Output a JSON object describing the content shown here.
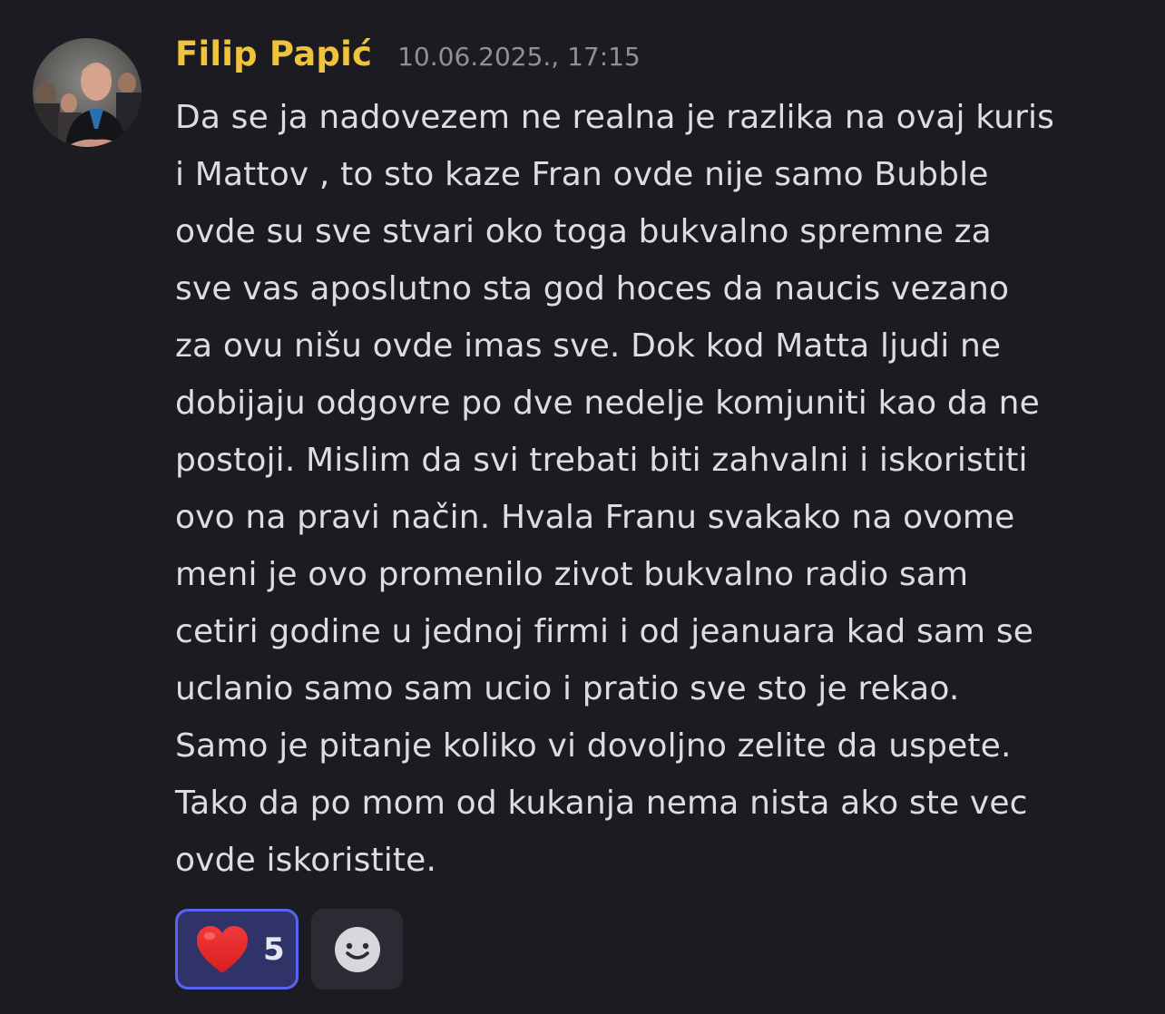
{
  "message": {
    "author": "Filip Papić",
    "timestamp": "10.06.2025., 17:15",
    "content_lines": [
      "Da se ja nadovezem ne realna je razlika na ovaj kuris",
      "i Mattov , to sto kaze Fran ovde nije samo Bubble",
      "ovde su sve stvari oko toga bukvalno spremne za",
      "sve vas aposlutno sta god hoces da naucis vezano",
      "za ovu nišu ovde imas sve. Dok kod Matta ljudi ne",
      "dobijaju odgovre po dve nedelje komjuniti kao da ne",
      "postoji. Mislim da svi trebati biti zahvalni i iskoristiti",
      "ovo na pravi način. Hvala Franu svakako na ovome",
      "meni je ovo promenilo zivot bukvalno radio sam",
      "cetiri godine u jednoj firmi i od jeanuara kad sam se",
      "uclanio samo sam ucio i pratio sve sto je rekao.",
      "Samo je pitanje koliko vi dovoljno zelite da uspete.",
      "Tako da po mom od kukanja nema nista ako ste vec",
      "ovde iskoristite."
    ]
  },
  "reactions": [
    {
      "icon": "heart-icon",
      "count": "5",
      "selected": true
    }
  ],
  "add_reaction": {
    "icon": "smiley-icon"
  },
  "colors": {
    "background": "#1b1b21",
    "username": "#f0c33c",
    "timestamp": "#8f909a",
    "text": "#dcdde2",
    "reaction_selected_bg": "#2f3367",
    "reaction_selected_border": "#5865f2",
    "add_reaction_bg": "#2b2c33"
  }
}
